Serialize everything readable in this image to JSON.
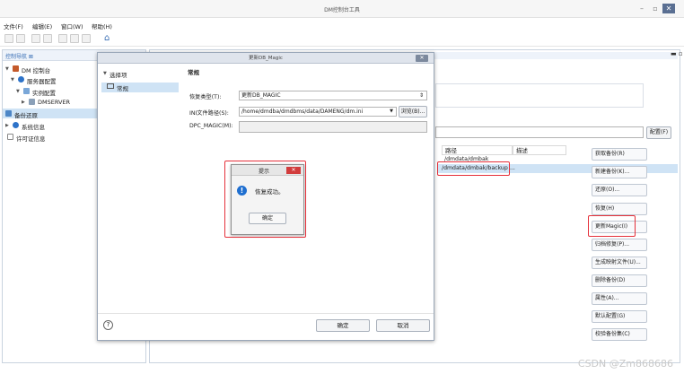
{
  "window": {
    "title": "DM控制台工具"
  },
  "menu": [
    "文件(F)",
    "编辑(E)",
    "窗口(W)",
    "帮助(H)"
  ],
  "left_panel": {
    "tab": "控制导航 ⊠",
    "tree": [
      "DM 控制台",
      "服务器配置",
      "实例配置",
      "DMSERVER",
      "备份还原",
      "系统信息",
      "许可证信息"
    ]
  },
  "right_area": {
    "config_button": "配置(F)",
    "table": {
      "headers": [
        "路径",
        "描述"
      ],
      "rows": [
        [
          "/dmdata/dmbak",
          ""
        ],
        [
          "/dmdata/dmbak/backup",
          "..."
        ]
      ]
    },
    "buttons": [
      "获取备份(R)",
      "新建备份(K)...",
      "还原(O)...",
      "恢复(H)",
      "更新Magic(I)",
      "归档修复(P)...",
      "生成映射文件(U)...",
      "删除备份(D)",
      "属性(A)...",
      "默认配置(G)",
      "校验备份集(C)"
    ]
  },
  "dialog": {
    "title": "更新DB_Magic",
    "nav_header": "选择项",
    "nav_item": "常规",
    "section": "常规",
    "restore_type_label": "恢复类型(T):",
    "restore_type_value": "更新DB_MAGIC",
    "ini_label": "INI文件路径(S):",
    "ini_value": "/home/dmdba/dmdbms/data/DAMENG/dm.ini",
    "browse_label": "浏览(B)...",
    "dpc_label": "DPC_MAGIC(M):",
    "help_symbol": "?",
    "ok_label": "确定",
    "cancel_label": "取消"
  },
  "alert": {
    "title": "提示",
    "message": "恢复成功。",
    "ok_label": "确定"
  },
  "watermark": "CSDN @Zm868686",
  "colors": {
    "highlight": "#e5303a",
    "selection": "#cfe3f5",
    "info": "#1f6fd0"
  }
}
